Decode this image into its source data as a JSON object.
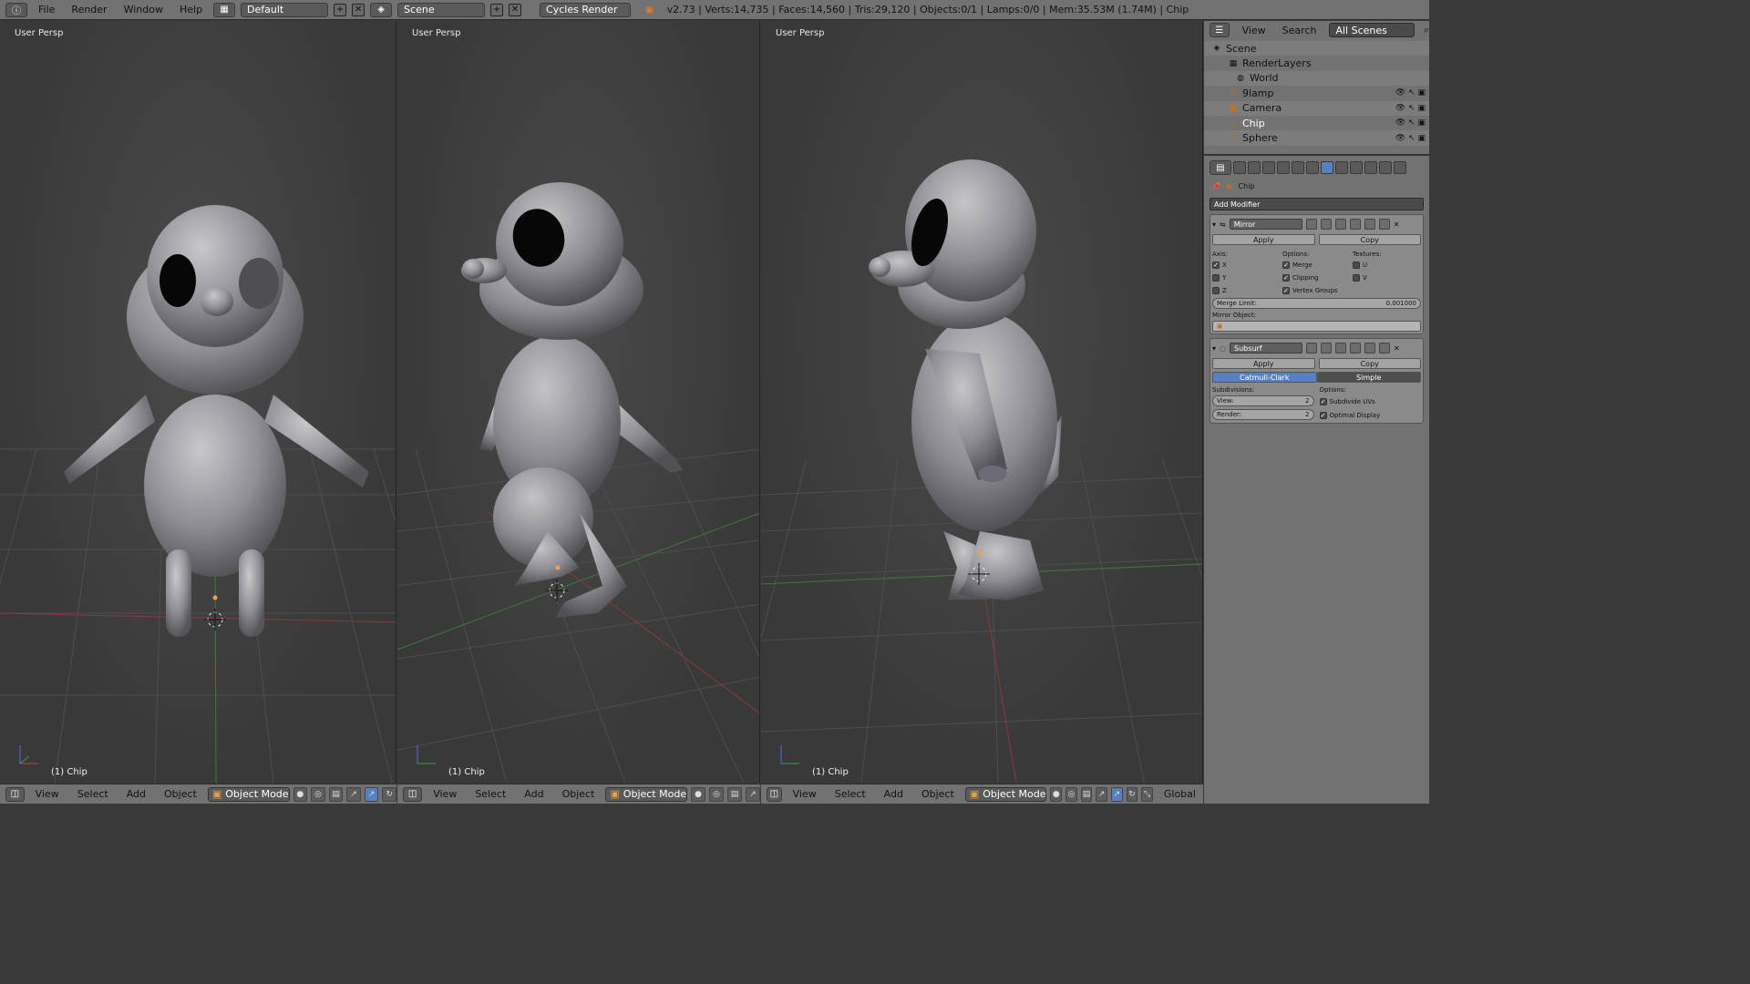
{
  "topbar": {
    "menus": [
      "File",
      "Render",
      "Window",
      "Help"
    ],
    "layout": "Default",
    "scene": "Scene",
    "engine": "Cycles Render",
    "stats": "v2.73 | Verts:14,735 | Faces:14,560 | Tris:29,120 | Objects:0/1 | Lamps:0/0 | Mem:35.53M (1.74M) | Chip"
  },
  "viewports": [
    {
      "label": "User Persp",
      "object": "(1) Chip"
    },
    {
      "label": "User Persp",
      "object": "(1) Chip"
    },
    {
      "label": "User Persp",
      "object": "(1) Chip"
    }
  ],
  "viewport_header": {
    "menus": [
      "View",
      "Select",
      "Add",
      "Object"
    ],
    "mode": "Object Mode",
    "orientation": "Global"
  },
  "outliner": {
    "menus": [
      "View",
      "Search"
    ],
    "scenes": "All Scenes",
    "items": [
      {
        "name": "Scene",
        "icon": "scene-icon"
      },
      {
        "name": "RenderLayers",
        "icon": "renderlayers-icon"
      },
      {
        "name": "World",
        "icon": "world-icon"
      },
      {
        "name": "9lamp",
        "icon": "mesh-icon"
      },
      {
        "name": "Camera",
        "icon": "camera-icon"
      },
      {
        "name": "Chip",
        "icon": "mesh-icon"
      },
      {
        "name": "Sphere",
        "icon": "mesh-icon"
      }
    ]
  },
  "properties": {
    "context": "Chip",
    "add_modifier": "Add Modifier",
    "mirror": {
      "name": "Mirror",
      "apply": "Apply",
      "copy": "Copy",
      "axis_label": "Axis:",
      "options_label": "Options:",
      "textures_label": "Textures:",
      "axis": [
        "X",
        "Y",
        "Z"
      ],
      "options": [
        "Merge",
        "Clipping",
        "Vertex Groups"
      ],
      "textures": [
        "U",
        "V"
      ],
      "merge_limit_label": "Merge Limit:",
      "merge_limit_value": "0.001000",
      "mirror_object_label": "Mirror Object:"
    },
    "subsurf": {
      "name": "Subsurf",
      "apply": "Apply",
      "copy": "Copy",
      "type_a": "Catmull-Clark",
      "type_b": "Simple",
      "subdivisions_label": "Subdivisions:",
      "options_label": "Options:",
      "view_label": "View:",
      "view_value": "2",
      "render_label": "Render:",
      "render_value": "2",
      "opt1": "Subdivide UVs",
      "opt2": "Optimal Display"
    }
  }
}
